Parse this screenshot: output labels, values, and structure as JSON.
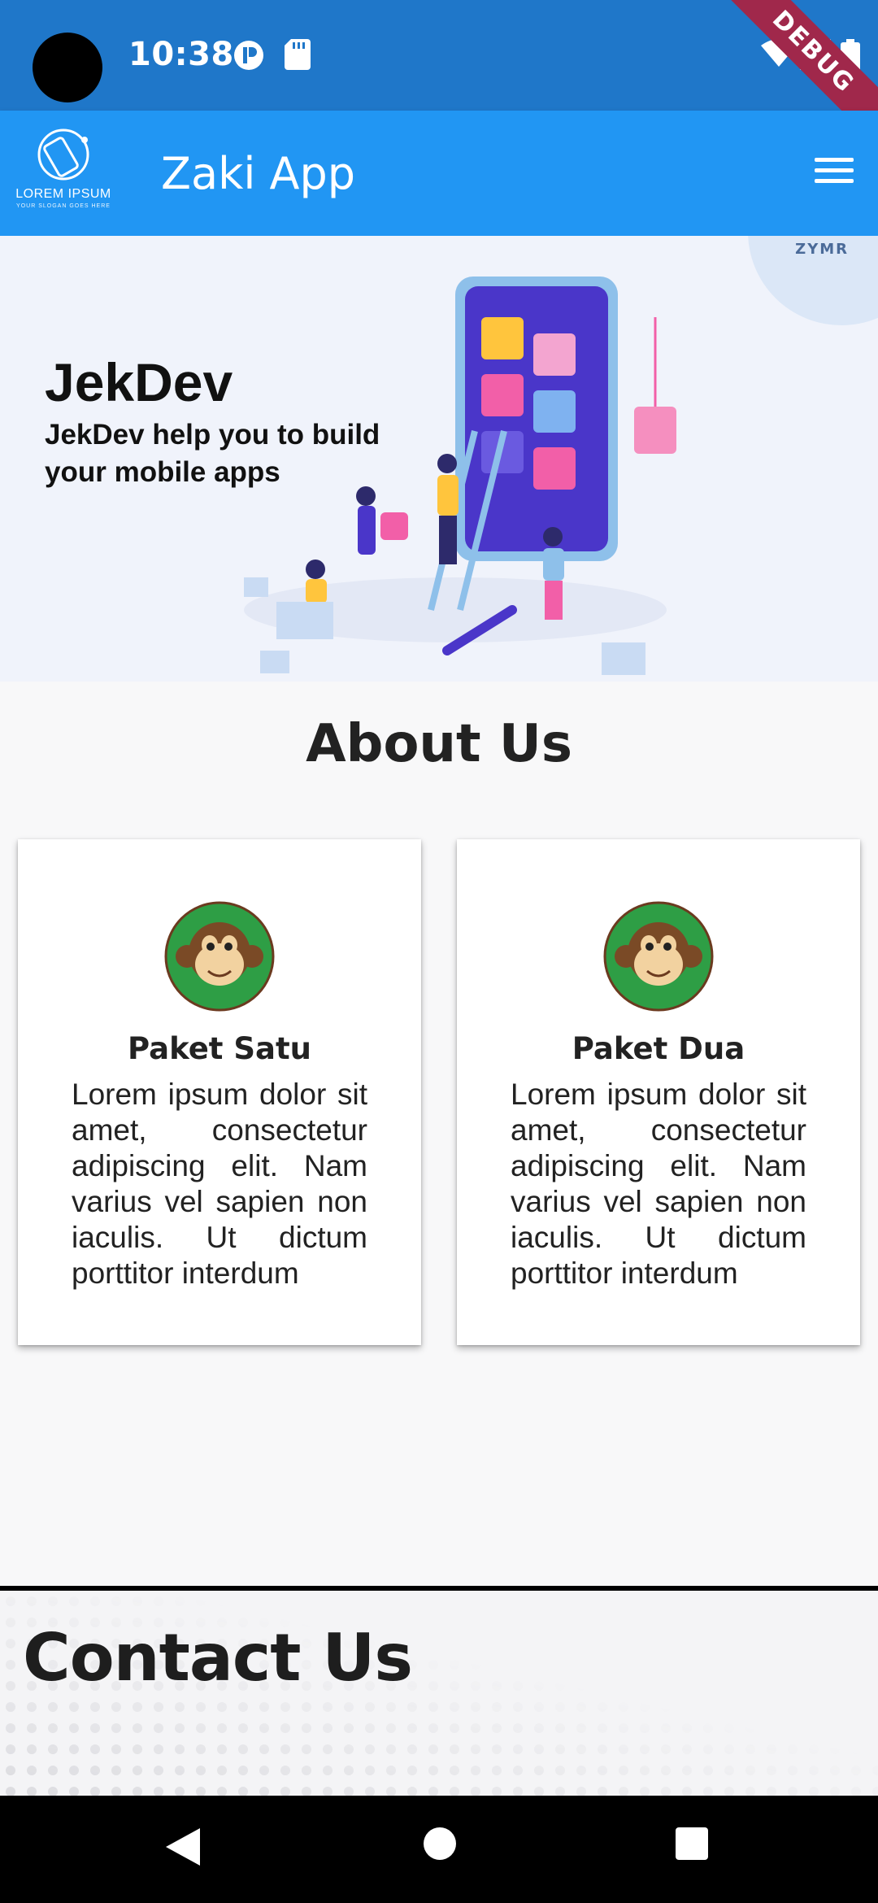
{
  "status_bar": {
    "time": "10:38",
    "icons": [
      "camera-hole",
      "notification-p-icon",
      "sd-card-icon",
      "wifi-icon",
      "signal-icon",
      "battery-icon"
    ],
    "debug_banner": "DEBUG"
  },
  "app_bar": {
    "title": "Zaki App",
    "logo_text": "LOREM IPSUM",
    "logo_sub": "YOUR SLOGAN GOES HERE",
    "menu_icon": "hamburger-menu-icon",
    "color": "#2196f3"
  },
  "hero": {
    "title": "JekDev",
    "subtitle": "JekDev help you to build your mobile apps",
    "brand": "ZYMR"
  },
  "about": {
    "title": "About Us",
    "cards": [
      {
        "title": "Paket Satu",
        "text": "Lorem ipsum dolor sit amet, consectetur adipiscing elit. Nam varius vel sapien non iaculis. Ut dictum porttitor interdum"
      },
      {
        "title": "Paket Dua",
        "text": "Lorem ipsum dolor sit amet, consectetur adipiscing elit. Nam varius vel sapien non iaculis. Ut dictum porttitor interdum"
      }
    ]
  },
  "contact": {
    "title": "Contact Us"
  },
  "nav_bar": {
    "buttons": [
      "back-icon",
      "home-icon",
      "recents-icon"
    ]
  }
}
